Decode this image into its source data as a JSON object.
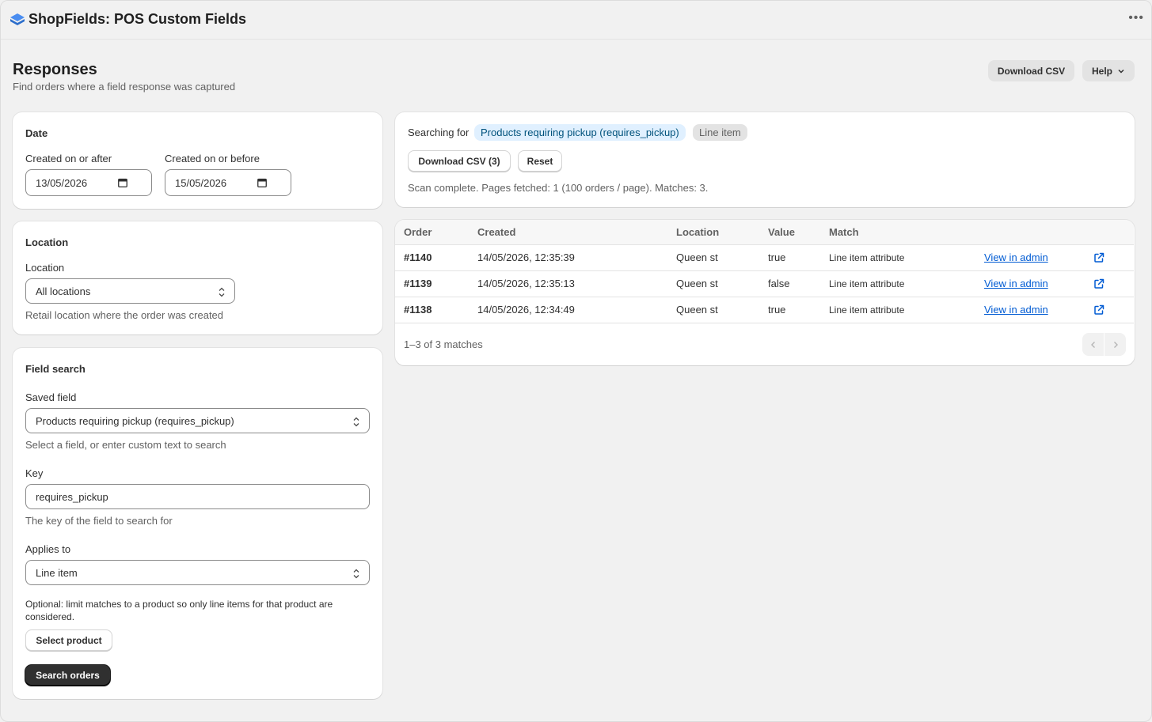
{
  "app": {
    "title": "ShopFields: POS Custom Fields",
    "icon": "stack-cube-icon",
    "accent_color": "#2c6ecb"
  },
  "header": {
    "title": "Responses",
    "subtitle": "Find orders where a field response was captured",
    "download_csv_label": "Download CSV",
    "help_label": "Help"
  },
  "date_card": {
    "title": "Date",
    "after_label": "Created on or after",
    "after_value": "13/05/2026",
    "before_label": "Created on or before",
    "before_value": "15/05/2026"
  },
  "location_card": {
    "title": "Location",
    "label": "Location",
    "value": "All locations",
    "help": "Retail location where the order was created"
  },
  "field_card": {
    "title": "Field search",
    "saved_field_label": "Saved field",
    "saved_field_value": "Products requiring pickup (requires_pickup)",
    "saved_field_help": "Select a field, or enter custom text to search",
    "key_label": "Key",
    "key_value": "requires_pickup",
    "key_help": "The key of the field to search for",
    "applies_label": "Applies to",
    "applies_value": "Line item",
    "product_help": "Optional: limit matches to a product so only line items for that product are considered.",
    "select_product_label": "Select product",
    "search_label": "Search orders"
  },
  "status": {
    "searching_for": "Searching for",
    "field_chip": "Products requiring pickup (requires_pickup)",
    "scope_chip": "Line item",
    "download_label": "Download CSV (3)",
    "reset_label": "Reset",
    "scan_text": "Scan complete. Pages fetched: 1 (100 orders / page). Matches: 3."
  },
  "table": {
    "columns": [
      "Order",
      "Created",
      "Location",
      "Value",
      "Match"
    ],
    "rows": [
      {
        "order": "#1140",
        "created": "14/05/2026, 12:35:39",
        "location": "Queen st",
        "value": "true",
        "match": "Line item attribute",
        "link": "View in admin"
      },
      {
        "order": "#1139",
        "created": "14/05/2026, 12:35:13",
        "location": "Queen st",
        "value": "false",
        "match": "Line item attribute",
        "link": "View in admin"
      },
      {
        "order": "#1138",
        "created": "14/05/2026, 12:34:49",
        "location": "Queen st",
        "value": "true",
        "match": "Line item attribute",
        "link": "View in admin"
      }
    ],
    "summary": "1–3 of 3 matches"
  }
}
